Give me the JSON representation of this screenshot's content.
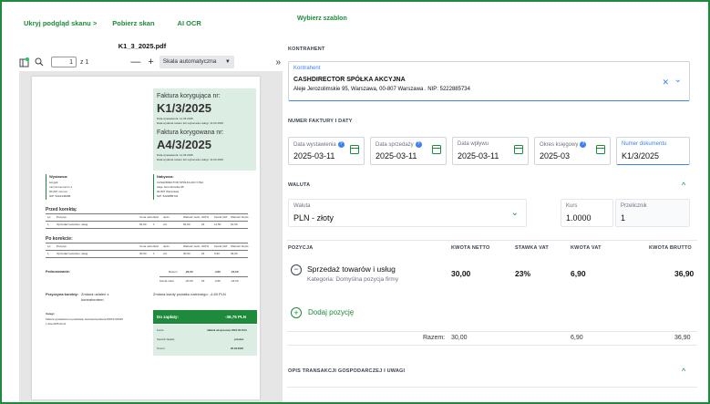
{
  "left": {
    "links": {
      "hide_preview": "Ukryj podgląd skanu",
      "hide_arrow": ">",
      "download": "Pobierz skan",
      "ai_ocr": "AI OCR"
    },
    "filename": "K1_3_2025.pdf",
    "pdfbar": {
      "page": "1",
      "of": "z 1",
      "minus": "—",
      "plus": "+",
      "scale": "Skala automatyczna",
      "caret": "▼",
      "toggle": "»"
    },
    "doc": {
      "title1": "Faktura korygująca nr:",
      "num1": "K1/3/2025",
      "d1a": "Data wystawienia: 11.03.2025",
      "d1b": "Data wydania towaru lub wykonania usługi: 11.03.2025",
      "title2": "Faktura korygowana nr:",
      "num2": "A4/3/2025",
      "d2a": "Data wystawienia: 11.03.2025",
      "d2b": "Data wydania towaru lub wykonania usługi: 11.03.2025",
      "seller_h": "Wystawca:",
      "seller": [
        "korygik",
        "mmmmmmmmm 1",
        "00-007 mmmm",
        "NIP: 5224446688"
      ],
      "buyer_h": "Nabywca:",
      "buyer": [
        "CASHDIRECTOR SPÓŁKA AKCYJNA",
        "Aleje Jerozolimskie 95",
        "00-807 Warszawa",
        "NIP: 5222885734"
      ],
      "before": "Przed korektą:",
      "after": "Po korekcie:",
      "th": [
        "Lp.",
        "Pozycja",
        "Cena netto",
        "Ilość",
        "Jedn.",
        "Wartość netto",
        "VAT%",
        "Kwota VAT",
        "Wartość brutto"
      ],
      "row_before": [
        "1.",
        "Sprzedaż towarów i usług",
        "50,00",
        "1",
        "szt.",
        "50,00",
        "23",
        "11,50",
        "61,50"
      ],
      "row_after": [
        "1.",
        "Sprzedaż towarów i usług",
        "30,00",
        "1",
        "szt.",
        "30,00",
        "23",
        "6,90",
        "36,90"
      ],
      "totals_h": "Podsumowanie:",
      "totals1": [
        "Razem",
        "-20,00",
        "-4,60",
        "-24,60"
      ],
      "totals2": [
        "Kwota netto",
        "-20,00",
        "23",
        "-4,60",
        "-24,60"
      ],
      "reason_h": "Przyczyna korekty:",
      "reason": "Zmiana ustaleń z kontrahentem.",
      "change": "Zmiana kwoty podatku należnego: -4,60 PLN",
      "notes_h": "Uwagi:",
      "notes": [
        "Faktura wystawiona na podstawie zamówienia klienta PRO/1/3/2025",
        "z dnia 2025-03-11"
      ],
      "pay_label": "Do zapłaty:",
      "pay_value": "-36,75 PLN",
      "pay_rows": [
        [
          "Konto:",
          "mBank ekspresowo 2024 00 PLN"
        ],
        [
          "Sposób zapłaty:",
          "przelew"
        ],
        [
          "Termin:",
          "25.03.2025"
        ]
      ]
    }
  },
  "right": {
    "template": "Wybierz szablon",
    "contractor_h": "KONTRAHENT",
    "contractor_label": "Kontrahent",
    "contractor_name": "CASHDIRECTOR SPÓŁKA AKCYJNA",
    "contractor_addr": "Aleje Jerozolimskie 95, Warszawa, 00-807 Warszawa . NIP: 5222885734",
    "close": "✕",
    "chevron": "⌄",
    "dates_h": "NUMER FAKTURY I DATY",
    "fields": [
      {
        "label": "Data wystawienia",
        "value": "2025-03-11"
      },
      {
        "label": "Data sprzedaży",
        "value": "2025-03-11"
      },
      {
        "label": "Data wpływu",
        "value": "2025-03-11"
      },
      {
        "label": "Okres księgowy",
        "value": "2025-03"
      },
      {
        "label": "Numer dokumentu",
        "value": "K1/3/2025"
      }
    ],
    "qmark": "?",
    "currency_h": "WALUTA",
    "currency_label": "Waluta",
    "currency_value": "PLN - złoty",
    "rate_label": "Kurs",
    "rate_value": "1.0000",
    "mult_label": "Przelicznik",
    "mult_value": "1",
    "up": "^",
    "pos_headers": [
      "POZYCJA",
      "KWOTA NETTO",
      "STAWKA VAT",
      "KWOTA VAT",
      "KWOTA BRUTTO"
    ],
    "item_title": "Sprzedaż towarów i usług",
    "item_cat": "Kategoria: Domyślna pozycja firmy",
    "item_values": [
      "30,00",
      "23%",
      "6,90",
      "36,90"
    ],
    "minus": "−",
    "add": "Dodaj pozycję",
    "plus": "+",
    "sum_label": "Razem:",
    "sum_values": [
      "30,00",
      "6,90",
      "36,90"
    ],
    "desc_h": "OPIS TRANSAKCJI GOSPODARCZEJ I UWAGI"
  }
}
